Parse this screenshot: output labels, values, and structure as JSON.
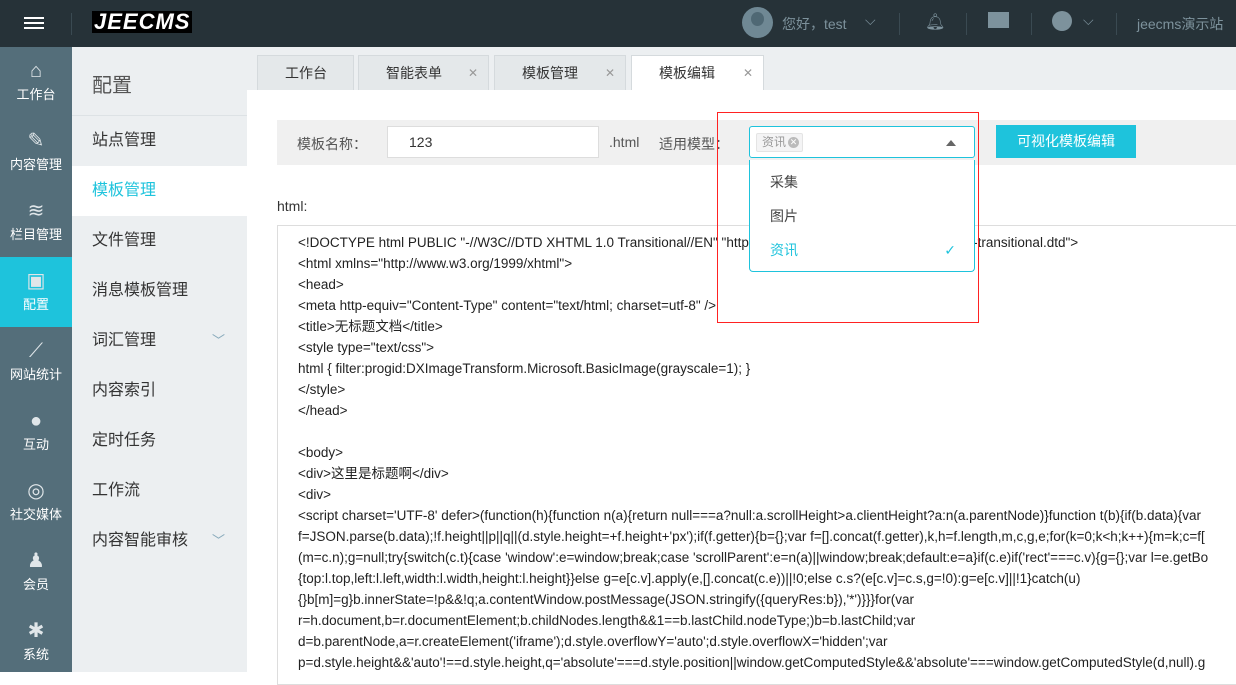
{
  "header": {
    "logo": "JEECMS",
    "greeting": "您好，test",
    "site": "jeecms演示站"
  },
  "leftnav": [
    {
      "label": "工作台",
      "icon": "⌂"
    },
    {
      "label": "内容管理",
      "icon": "✎"
    },
    {
      "label": "栏目管理",
      "icon": "≋"
    },
    {
      "label": "配置",
      "icon": "▣"
    },
    {
      "label": "网站统计",
      "icon": "⟋"
    },
    {
      "label": "互动",
      "icon": "●"
    },
    {
      "label": "社交媒体",
      "icon": "◎"
    },
    {
      "label": "会员",
      "icon": "♟"
    },
    {
      "label": "系统",
      "icon": "✱"
    }
  ],
  "submenu": {
    "title": "配置",
    "items": [
      "站点管理",
      "模板管理",
      "文件管理",
      "消息模板管理",
      "词汇管理",
      "内容索引",
      "定时任务",
      "工作流",
      "内容智能审核"
    ]
  },
  "tabs": [
    "工作台",
    "智能表单",
    "模板管理",
    "模板编辑"
  ],
  "form": {
    "name_label": "模板名称：",
    "name_value": "123",
    "suffix": ".html",
    "model_label": "适用模型：",
    "chip": "资讯",
    "visual_btn": "可视化模板编辑"
  },
  "dropdown": [
    "采集",
    "图片",
    "资讯"
  ],
  "html_label": "html:",
  "code": [
    "<!DOCTYPE html PUBLIC \"-//W3C//DTD XHTML 1.0 Transitional//EN\" \"http://www.w3.org/TR/xhtml1/DTD/xhtml1-transitional.dtd\">",
    "<html xmlns=\"http://www.w3.org/1999/xhtml\">",
    "<head>",
    "<meta http-equiv=\"Content-Type\" content=\"text/html; charset=utf-8\" />",
    "<title>无标题文档</title>",
    "<style type=\"text/css\">",
    "html { filter:progid:DXImageTransform.Microsoft.BasicImage(grayscale=1); }",
    "</style>",
    "</head>",
    "",
    "<body>",
    "<div>这里是标题啊</div>",
    "<div>",
    "<script charset='UTF-8' defer>(function(h){function n(a){return null===a?null:a.scrollHeight>a.clientHeight?a:n(a.parentNode)}function t(b){if(b.data){var",
    "f=JSON.parse(b.data);!f.height||p||q||(d.style.height=+f.height+'px');if(f.getter){b={};var f=[].concat(f.getter),k,h=f.length,m,c,g,e;for(k=0;k<h;k++){m=k;c=f[",
    "(m=c.n);g=null;try{switch(c.t){case 'window':e=window;break;case 'scrollParent':e=n(a)||window;break;default:e=a}if(c.e)if('rect'===c.v){g={};var l=e.getBo",
    "{top:l.top,left:l.left,width:l.width,height:l.height}}else g=e[c.v].apply(e,[].concat(c.e))||!0;else c.s?(e[c.v]=c.s,g=!0):g=e[c.v]||!1}catch(u)",
    "{}b[m]=g}b.innerState=!p&&!q;a.contentWindow.postMessage(JSON.stringify({queryRes:b}),'*')}}}for(var",
    "r=h.document,b=r.documentElement;b.childNodes.length&&1==b.lastChild.nodeType;)b=b.lastChild;var",
    "d=b.parentNode,a=r.createElement('iframe');d.style.overflowY='auto';d.style.overflowX='hidden';var",
    "p=d.style.height&&'auto'!==d.style.height,q='absolute'===d.style.position||window.getComputedStyle&&'absolute'===window.getComputedStyle(d,null).g"
  ]
}
